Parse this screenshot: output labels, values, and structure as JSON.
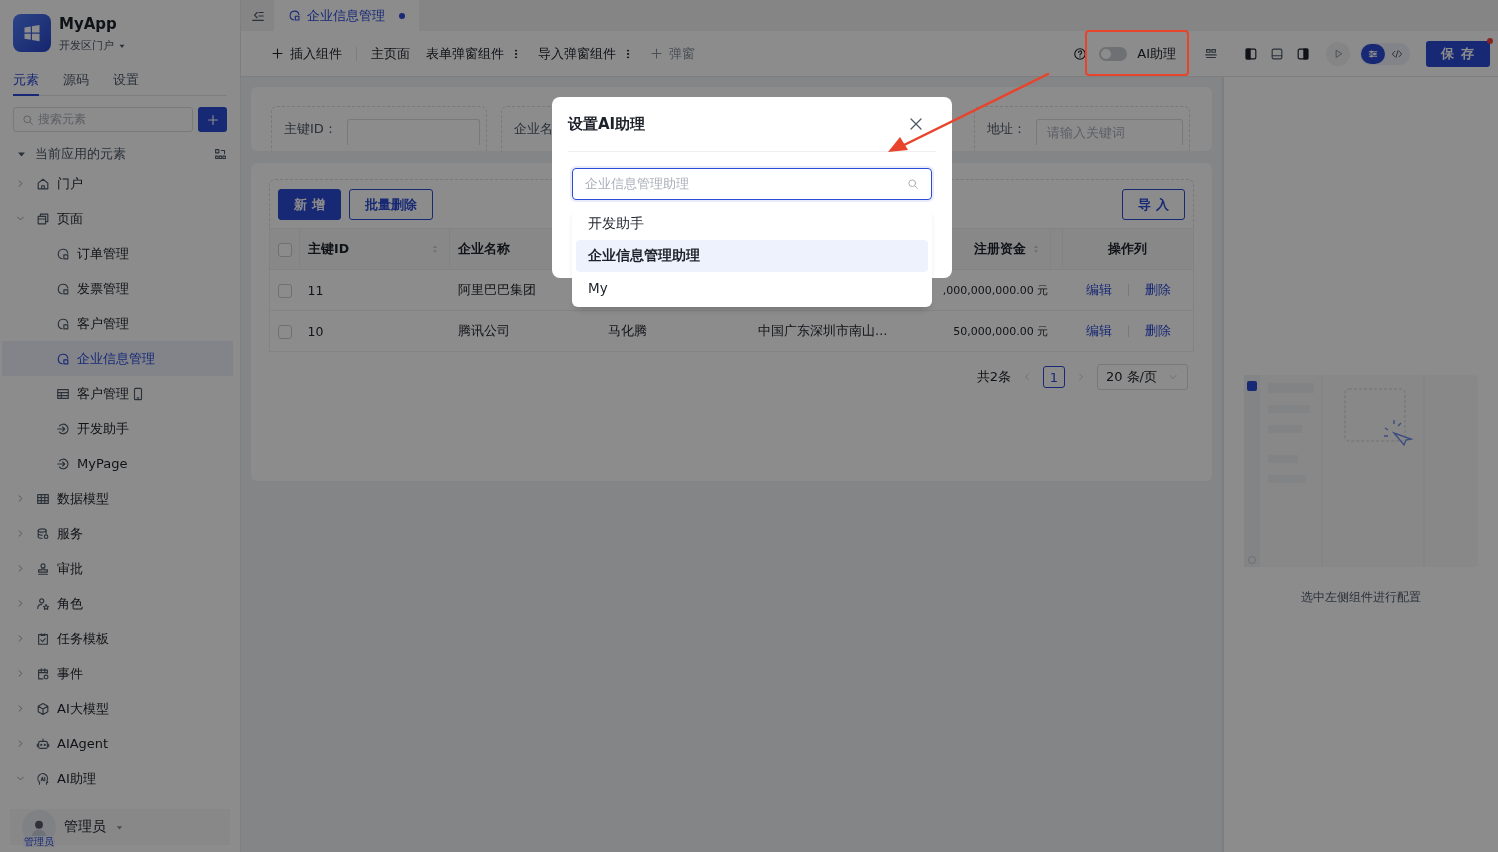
{
  "app": {
    "name": "MyApp",
    "portal": "开发区门户"
  },
  "sidebar_tabs": [
    {
      "label": "元素",
      "selected": true
    },
    {
      "label": "源码",
      "selected": false
    },
    {
      "label": "设置",
      "selected": false
    }
  ],
  "element_search": {
    "placeholder": "搜索元素"
  },
  "tree": {
    "label": "当前应用的元素",
    "expanded": true,
    "children": [
      {
        "label": "门户",
        "kind": "portal",
        "expanded": false,
        "selected": false
      },
      {
        "label": "页面",
        "kind": "pages",
        "expanded": true,
        "selected": false,
        "children": [
          {
            "label": "订单管理",
            "kind": "page",
            "selected": false
          },
          {
            "label": "发票管理",
            "kind": "page",
            "selected": false
          },
          {
            "label": "客户管理",
            "kind": "page",
            "selected": false
          },
          {
            "label": "企业信息管理",
            "kind": "page",
            "selected": true
          },
          {
            "label": "客户管理",
            "kind": "mobile",
            "selected": false
          },
          {
            "label": "开发助手",
            "kind": "assistant",
            "selected": false
          },
          {
            "label": "MyPage",
            "kind": "assistant",
            "selected": false
          }
        ]
      },
      {
        "label": "数据模型",
        "kind": "model",
        "expanded": false,
        "selected": false
      },
      {
        "label": "服务",
        "kind": "service",
        "expanded": false,
        "selected": false
      },
      {
        "label": "审批",
        "kind": "approval",
        "expanded": false,
        "selected": false
      },
      {
        "label": "角色",
        "kind": "role",
        "expanded": false,
        "selected": false
      },
      {
        "label": "任务模板",
        "kind": "task",
        "expanded": false,
        "selected": false
      },
      {
        "label": "事件",
        "kind": "event",
        "expanded": false,
        "selected": false
      },
      {
        "label": "AI大模型",
        "kind": "llm",
        "expanded": false,
        "selected": false
      },
      {
        "label": "AIAgent",
        "kind": "agent",
        "expanded": false,
        "selected": false
      },
      {
        "label": "AI助理",
        "kind": "ai",
        "expanded": true,
        "selected": false
      }
    ]
  },
  "user": {
    "avatar_label": "管理员",
    "name": "管理员"
  },
  "editor_tabs": [
    {
      "label": "企业信息管理",
      "selected": true,
      "modified": true
    }
  ],
  "toolbar": {
    "items": [
      {
        "label": "插入组件",
        "kind": "plus",
        "disabled": false
      },
      {
        "label": "主页面",
        "kind": "plain",
        "disabled": false
      },
      {
        "label": "表单弹窗组件",
        "kind": "menu",
        "disabled": false
      },
      {
        "label": "导入弹窗组件",
        "kind": "menu",
        "disabled": false
      },
      {
        "label": "弹窗",
        "kind": "plus",
        "disabled": true
      }
    ],
    "ai_toggle": {
      "label": "AI助理",
      "on": false
    },
    "panels": [
      {
        "kind": "left",
        "on": true
      },
      {
        "kind": "bottom",
        "on": false
      },
      {
        "kind": "right",
        "on": true
      }
    ],
    "view_modes": [
      {
        "kind": "design",
        "selected": true
      },
      {
        "kind": "code",
        "selected": false
      }
    ],
    "save_button": {
      "label": "保 存",
      "badge_dot": true
    }
  },
  "filters": [
    {
      "label": "主键ID："
    },
    {
      "label": "企业名"
    },
    {
      "label": "地址：",
      "placeholder": "请输入关键词"
    }
  ],
  "table": {
    "actions": [
      "新 增",
      "批量删除"
    ],
    "import_button": "导 入",
    "header_checked": false,
    "columns": [
      {
        "label": "主键ID",
        "kind": "text",
        "sortable": true
      },
      {
        "label": "企业名称",
        "kind": "text",
        "sortable": false
      },
      {
        "kind": "text"
      },
      {
        "kind": "text"
      },
      {
        "label": "注册资金",
        "kind": "money",
        "sortable": true
      },
      {
        "label": "操作列",
        "kind": "actions",
        "sortable": false
      }
    ],
    "rows": [
      {
        "checked": false,
        "id": "11",
        "name": "阿里巴巴集团",
        "capital": ",000,000,000.00 元",
        "actions": [
          "编辑",
          "删除"
        ]
      },
      {
        "checked": false,
        "id": "10",
        "name": "腾讯公司",
        "column_3": "马化腾",
        "column_4": "中国广东深圳市南山…",
        "capital": "50,000,000.00 元",
        "actions": [
          "编辑",
          "删除"
        ]
      }
    ]
  },
  "pagination": {
    "total": "共2条",
    "pages": [
      {
        "label": "1",
        "selected": true
      }
    ],
    "page_size": "20 条/页"
  },
  "right_panel": {
    "hint": "选中左侧组件进行配置"
  },
  "modal": {
    "open": true,
    "title": "设置AI助理",
    "select": {
      "placeholder": "企业信息管理助理",
      "options": [
        {
          "label": "开发助手",
          "selected": false
        },
        {
          "label": "企业信息管理助理",
          "selected": true
        },
        {
          "label": "My",
          "selected": false
        }
      ]
    }
  },
  "annotation": {
    "highlight_box": true,
    "arrow": true
  }
}
